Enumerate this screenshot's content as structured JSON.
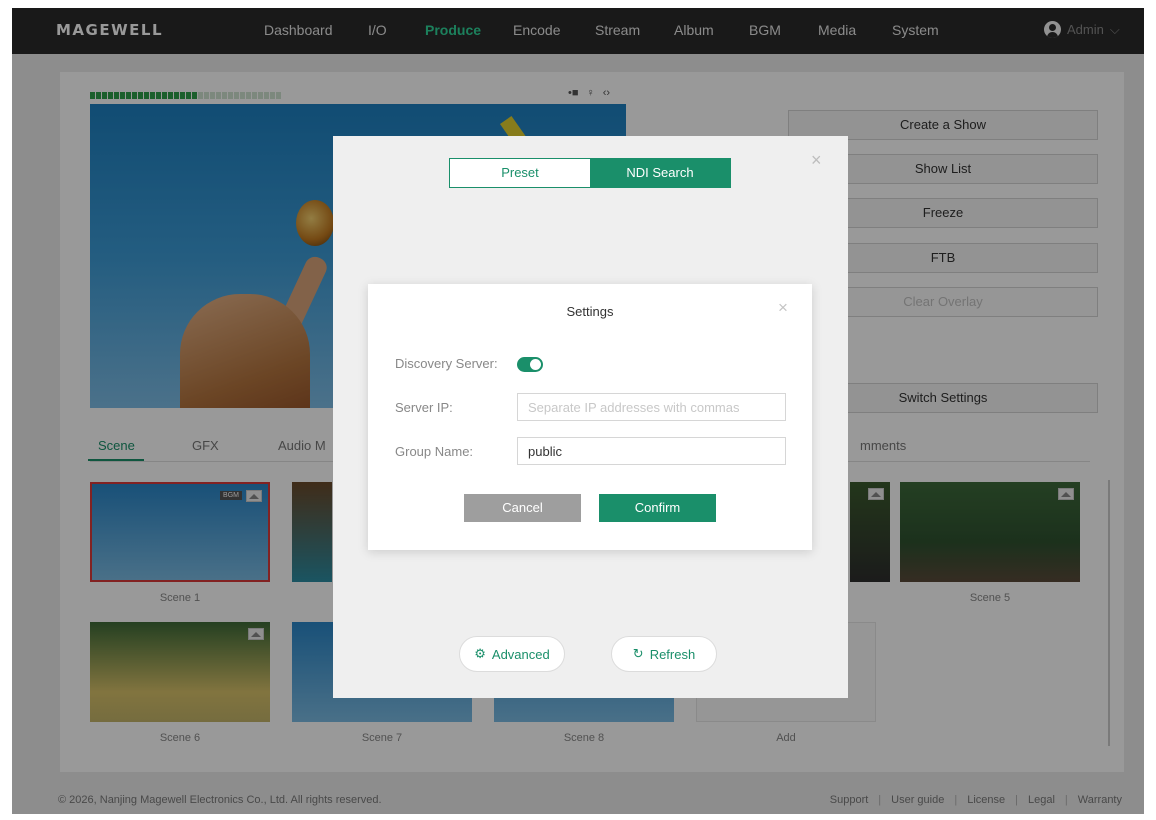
{
  "nav": {
    "logo": "MAGEWELL",
    "items": [
      "Dashboard",
      "I/O",
      "Produce",
      "Encode",
      "Stream",
      "Album",
      "BGM",
      "Media",
      "System"
    ],
    "active_item": "Produce",
    "user": "Admin",
    "user_caret": "⌵",
    "active_color": "#2fd59a"
  },
  "status_icons": [
    "•■",
    "♀",
    "‹›"
  ],
  "side_buttons": [
    "Create a Show",
    "Show List",
    "Freeze",
    "FTB",
    "Clear Overlay",
    "Switch Settings"
  ],
  "tabs": [
    "Scene",
    "GFX",
    "Audio M",
    "mments"
  ],
  "scenes": [
    "Scene 1",
    "Scene 5",
    "Scene 6",
    "Scene 7",
    "Scene 8",
    "Add"
  ],
  "scene1_badge": "BGM",
  "footer": {
    "copyright": "© 2026, Nanjing Magewell Electronics Co., Ltd. All rights reserved.",
    "links": [
      "Support",
      "User guide",
      "License",
      "Legal",
      "Warranty"
    ]
  },
  "ndi_dialog": {
    "tabs": [
      "Preset",
      "NDI Search"
    ],
    "active_tab": "NDI Search",
    "close": "×",
    "advanced_label": "Advanced",
    "refresh_label": "Refresh",
    "advanced_icon": "⚙",
    "refresh_icon": "↻"
  },
  "settings_dialog": {
    "title": "Settings",
    "close": "×",
    "discovery_label": "Discovery Server:",
    "discovery_enabled": true,
    "server_ip_label": "Server IP:",
    "server_ip_value": "",
    "server_ip_placeholder": "Separate IP addresses with commas",
    "group_label": "Group Name:",
    "group_value": "public",
    "cancel": "Cancel",
    "confirm": "Confirm"
  },
  "accent_color": "#1a8f6a"
}
